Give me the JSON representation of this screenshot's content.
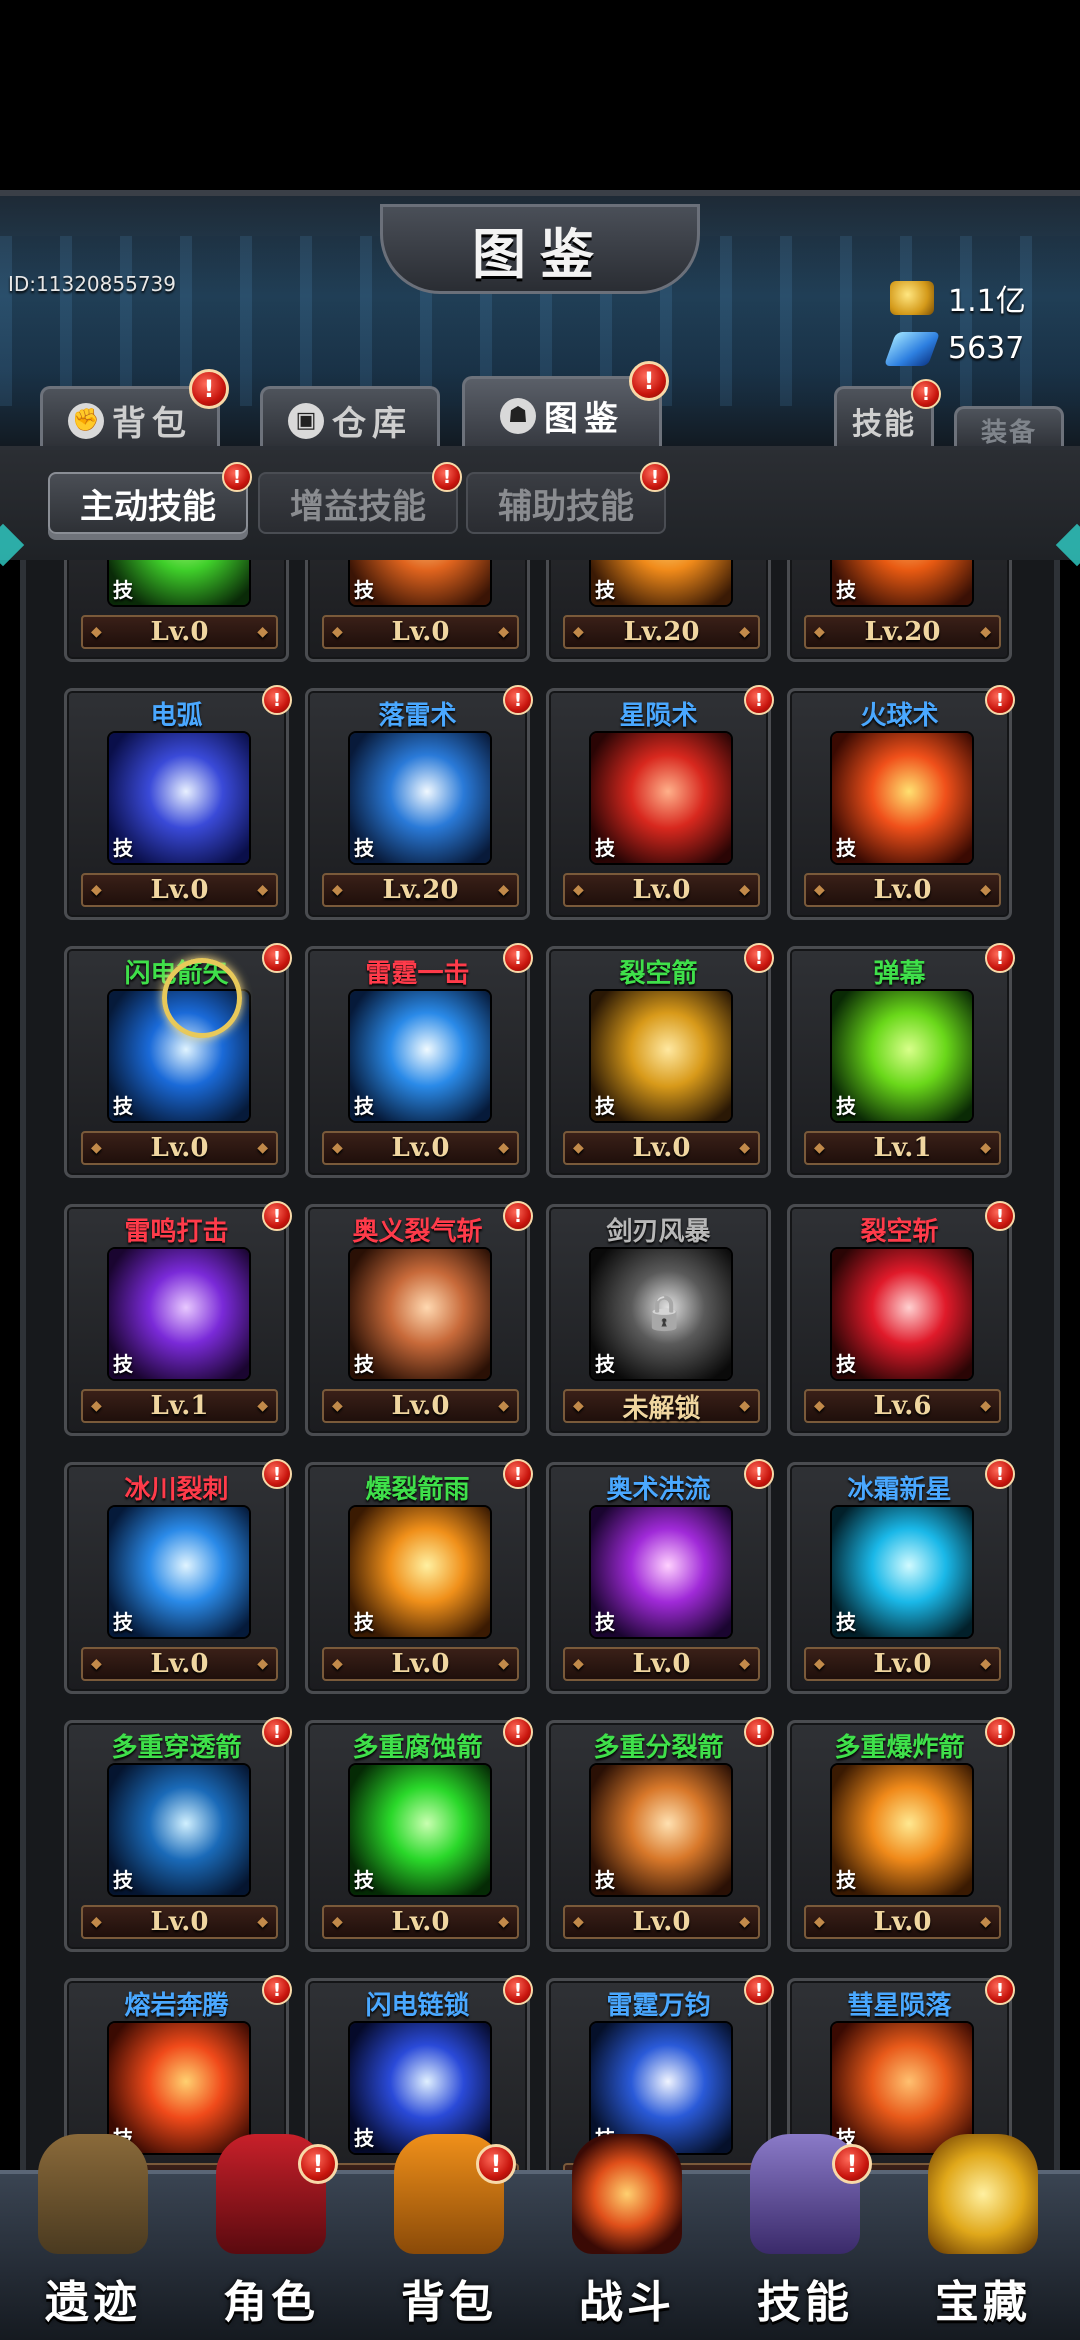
{
  "header": {
    "title": "图鉴",
    "user_id": "ID:11320855739",
    "gold": "1.1亿",
    "gems": "5637"
  },
  "main_tabs": [
    {
      "label": "背包",
      "icon": "fist-icon",
      "badge": "!"
    },
    {
      "label": "仓库",
      "icon": "chest-icon",
      "badge": ""
    },
    {
      "label": "图鉴",
      "icon": "figures-icon",
      "badge": "!"
    },
    {
      "label": "技能",
      "icon": "",
      "badge": "!"
    },
    {
      "label": "装备",
      "icon": "",
      "badge": ""
    }
  ],
  "sub_tabs": [
    {
      "label": "主动技能",
      "badge": "!"
    },
    {
      "label": "增益技能",
      "badge": "!"
    },
    {
      "label": "辅助技能",
      "badge": "!"
    }
  ],
  "skill_tag": "技",
  "skills": [
    {
      "name": "",
      "level": "Lv.0",
      "color": "green",
      "art": [
        "#0a2a08",
        "#3fcf2a",
        "#b8ff8a"
      ],
      "badge": false
    },
    {
      "name": "",
      "level": "Lv.0",
      "color": "orange",
      "art": [
        "#3a1405",
        "#e0641e",
        "#ffd28a"
      ],
      "badge": false
    },
    {
      "name": "",
      "level": "Lv.20",
      "color": "orange",
      "art": [
        "#3a1a05",
        "#f08a1a",
        "#ffe28a"
      ],
      "badge": false
    },
    {
      "name": "",
      "level": "Lv.20",
      "color": "orange",
      "art": [
        "#3a1005",
        "#e85a12",
        "#ffc070"
      ],
      "badge": false
    },
    {
      "name": "电弧",
      "level": "Lv.0",
      "color": "blue",
      "art": [
        "#0a0f4a",
        "#3a4ad8",
        "#e8f0ff"
      ],
      "badge": true
    },
    {
      "name": "落雷术",
      "level": "Lv.20",
      "color": "blue",
      "art": [
        "#081a3a",
        "#2a7ad8",
        "#f0f8ff"
      ],
      "badge": true
    },
    {
      "name": "星陨术",
      "level": "Lv.0",
      "color": "blue",
      "art": [
        "#2a0505",
        "#d8281e",
        "#ffb08a"
      ],
      "badge": true
    },
    {
      "name": "火球术",
      "level": "Lv.0",
      "color": "blue",
      "art": [
        "#3a0a02",
        "#f0501a",
        "#ffe070"
      ],
      "badge": true
    },
    {
      "name": "闪电箭矢",
      "level": "Lv.0",
      "color": "green",
      "art": [
        "#061a3a",
        "#1a6ad8",
        "#e0f4ff"
      ],
      "badge": true
    },
    {
      "name": "雷霆一击",
      "level": "Lv.0",
      "color": "red",
      "art": [
        "#061a3a",
        "#2a8ae8",
        "#f0faff"
      ],
      "badge": true
    },
    {
      "name": "裂空箭",
      "level": "Lv.0",
      "color": "green",
      "art": [
        "#2a1805",
        "#d89a1a",
        "#ffe8a0"
      ],
      "badge": true
    },
    {
      "name": "弹幕",
      "level": "Lv.1",
      "color": "green",
      "art": [
        "#0a2a05",
        "#6ad81a",
        "#d8ff8a"
      ],
      "badge": true
    },
    {
      "name": "雷鸣打击",
      "level": "Lv.1",
      "color": "red",
      "art": [
        "#1a0530",
        "#7a2ad8",
        "#e8c8ff"
      ],
      "badge": true
    },
    {
      "name": "奥义裂气斩",
      "level": "Lv.0",
      "color": "red",
      "art": [
        "#2a1005",
        "#c86a3a",
        "#ffd8b0"
      ],
      "badge": true
    },
    {
      "name": "剑刃风暴",
      "level": "未解锁",
      "color": "gray",
      "art": [
        "#0a0a0a",
        "#5a5a5a",
        "#e0e0e0"
      ],
      "badge": false
    },
    {
      "name": "裂空斩",
      "level": "Lv.6",
      "color": "red",
      "art": [
        "#2a0505",
        "#e01a2a",
        "#ffd0d0"
      ],
      "badge": true
    },
    {
      "name": "冰川裂刺",
      "level": "Lv.0",
      "color": "red",
      "art": [
        "#051a3a",
        "#2a8ae8",
        "#e0f4ff"
      ],
      "badge": true
    },
    {
      "name": "爆裂箭雨",
      "level": "Lv.0",
      "color": "green",
      "art": [
        "#3a1a02",
        "#f0901a",
        "#fff0a0"
      ],
      "badge": true
    },
    {
      "name": "奥术洪流",
      "level": "Lv.0",
      "color": "blue",
      "art": [
        "#1a0530",
        "#a02ad8",
        "#ffd0ff"
      ],
      "badge": true
    },
    {
      "name": "冰霜新星",
      "level": "Lv.0",
      "color": "blue",
      "art": [
        "#02202a",
        "#1ab8e8",
        "#d0faff"
      ],
      "badge": true
    },
    {
      "name": "多重穿透箭",
      "level": "Lv.0",
      "color": "green",
      "art": [
        "#051530",
        "#1a6ab8",
        "#d0f0ff"
      ],
      "badge": true
    },
    {
      "name": "多重腐蚀箭",
      "level": "Lv.0",
      "color": "green",
      "art": [
        "#052a05",
        "#2ad82a",
        "#c8ffb0"
      ],
      "badge": true
    },
    {
      "name": "多重分裂箭",
      "level": "Lv.0",
      "color": "green",
      "art": [
        "#2a1005",
        "#d8782a",
        "#ffe0b0"
      ],
      "badge": true
    },
    {
      "name": "多重爆炸箭",
      "level": "Lv.0",
      "color": "green",
      "art": [
        "#3a1a02",
        "#f08a1a",
        "#ffe890"
      ],
      "badge": true
    },
    {
      "name": "熔岩奔腾",
      "level": "",
      "color": "blue",
      "art": [
        "#3a0a02",
        "#f04a1a",
        "#ffd070"
      ],
      "badge": true
    },
    {
      "name": "闪电链锁",
      "level": "",
      "color": "blue",
      "art": [
        "#050a2a",
        "#2a4ad8",
        "#e0f0ff"
      ],
      "badge": true
    },
    {
      "name": "雷霆万钧",
      "level": "",
      "color": "blue",
      "art": [
        "#05102a",
        "#2a5ad8",
        "#f0f4ff"
      ],
      "badge": true
    },
    {
      "name": "彗星陨落",
      "level": "",
      "color": "blue",
      "art": [
        "#3a0a02",
        "#e85a1a",
        "#ffc070"
      ],
      "badge": true
    }
  ],
  "bottom_nav": [
    {
      "label": "遗迹",
      "icon": "relic-totem-icon",
      "badge": false
    },
    {
      "label": "角色",
      "icon": "hooded-hero-icon",
      "badge": true
    },
    {
      "label": "背包",
      "icon": "backpack-icon",
      "badge": true
    },
    {
      "label": "战斗",
      "icon": "fire-portal-icon",
      "badge": false
    },
    {
      "label": "技能",
      "icon": "spellbook-icon",
      "badge": true
    },
    {
      "label": "宝藏",
      "icon": "treasure-gold-icon",
      "badge": false
    }
  ]
}
